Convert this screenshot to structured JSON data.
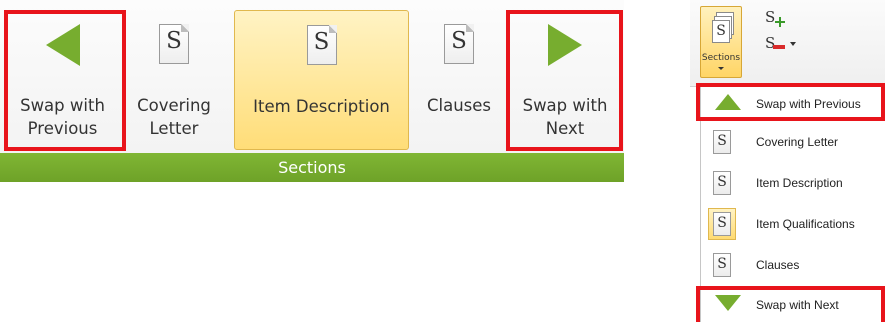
{
  "ribbon": {
    "buttons": [
      {
        "label": "Swap with\nPrevious",
        "icon": "triangle-left-icon"
      },
      {
        "label": "Covering\nLetter",
        "icon": "document-s-icon"
      },
      {
        "label": "Item Description",
        "icon": "document-s-icon",
        "selected": true
      },
      {
        "label": "Clauses",
        "icon": "document-s-icon"
      },
      {
        "label": "Swap with\nNext",
        "icon": "triangle-right-icon"
      }
    ],
    "group_label": "Sections",
    "icon_letter": "S"
  },
  "dropdown": {
    "button_label": "Sections",
    "items": [
      {
        "label": "Swap with Previous",
        "icon": "triangle-up-icon"
      },
      {
        "label": "Covering Letter",
        "icon": "document-s-icon"
      },
      {
        "label": "Item Description",
        "icon": "document-s-icon"
      },
      {
        "label": "Item Qualifications",
        "icon": "document-s-icon",
        "selected": true
      },
      {
        "label": "Clauses",
        "icon": "document-s-icon"
      },
      {
        "label": "Swap with Next",
        "icon": "triangle-down-icon"
      }
    ]
  },
  "colors": {
    "accent_green": "#77ad2f",
    "highlight_red": "#e8141b",
    "selected_fill": "#ffdd78"
  }
}
